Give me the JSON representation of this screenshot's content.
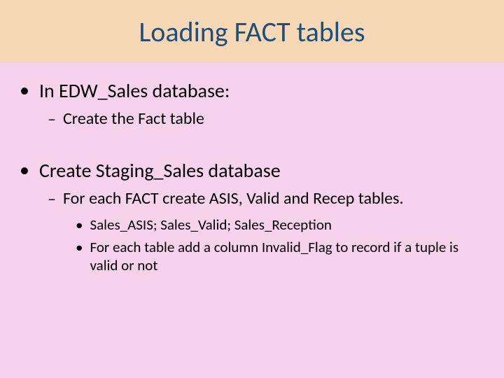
{
  "title": "Loading FACT tables",
  "items": {
    "b1": "In EDW_Sales database:",
    "b1_1": "Create the Fact table",
    "b2": "Create Staging_Sales database",
    "b2_1": "For each FACT create ASIS, Valid and Recep tables.",
    "b2_1_1": "Sales_ASIS; Sales_Valid; Sales_Reception",
    "b2_1_2": "For each table add a column Invalid_Flag to record if a tuple is valid or not"
  }
}
